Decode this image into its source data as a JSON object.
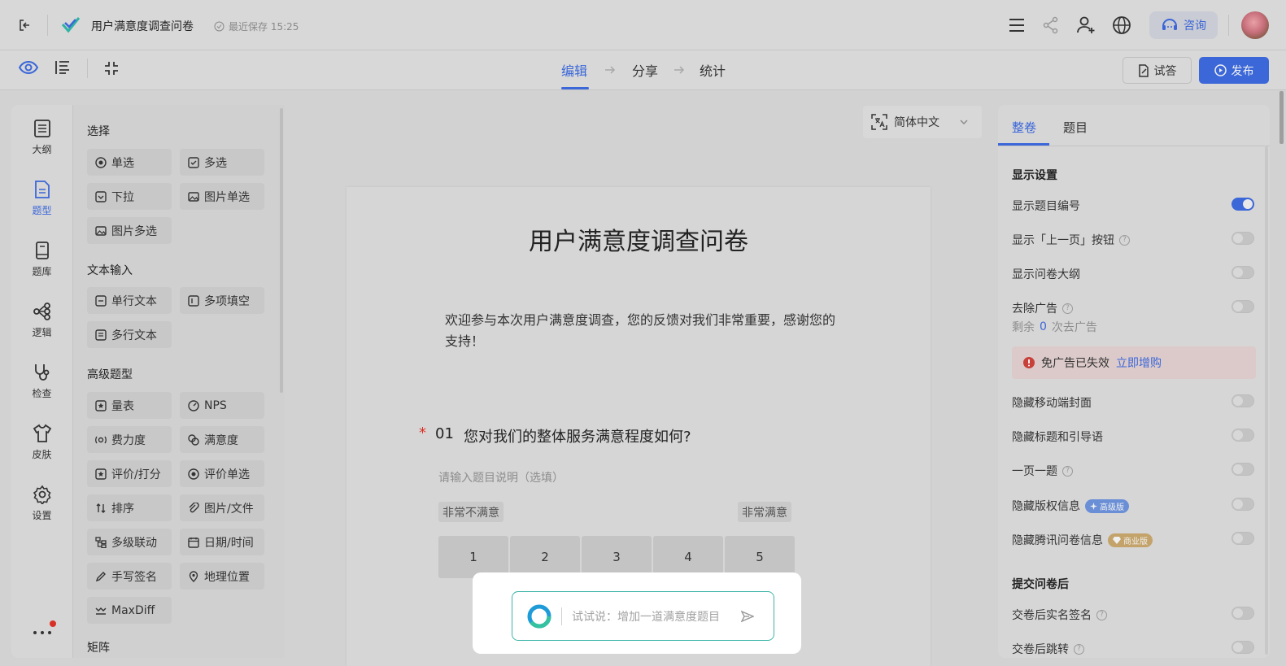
{
  "header": {
    "title": "用户满意度调查问卷",
    "saved": "最近保存 15:25",
    "consult": "咨询"
  },
  "steps": [
    "编辑",
    "分享",
    "统计"
  ],
  "actions": {
    "try": "试答",
    "publish": "发布"
  },
  "rail": [
    "大纲",
    "题型",
    "题库",
    "逻辑",
    "检查",
    "皮肤",
    "设置"
  ],
  "types": {
    "sections": [
      "选择",
      "文本输入",
      "高级题型",
      "矩阵"
    ],
    "choice": [
      "单选",
      "多选",
      "下拉",
      "图片单选",
      "图片多选"
    ],
    "text": [
      "单行文本",
      "多项填空",
      "多行文本"
    ],
    "advanced": [
      "量表",
      "NPS",
      "费力度",
      "满意度",
      "评价/打分",
      "评价单选",
      "排序",
      "图片/文件",
      "多级联动",
      "日期/时间",
      "手写签名",
      "地理位置",
      "MaxDiff"
    ]
  },
  "language": "简体中文",
  "survey": {
    "title": "用户满意度调查问卷",
    "intro": "欢迎参与本次用户满意度调查，您的反馈对我们非常重要，感谢您的支持！",
    "question": {
      "required_mark": "*",
      "number": "01",
      "text": "您对我们的整体服务满意程度如何?",
      "desc_placeholder": "请输入题目说明（选填）",
      "low_label": "非常不满意",
      "high_label": "非常满意",
      "scale": [
        "1",
        "2",
        "3",
        "4",
        "5"
      ]
    }
  },
  "ai": {
    "placeholder": "试试说：增加一道满意度题目"
  },
  "settings": {
    "tabs": [
      "整卷",
      "题目"
    ],
    "display_header": "显示设置",
    "rows": {
      "show_number": "显示题目编号",
      "show_prev": "显示「上一页」按钮",
      "show_outline": "显示问卷大纲",
      "remove_ads": "去除广告",
      "ads_left_prefix": "剩余",
      "ads_left_count": "0",
      "ads_left_suffix": "次去广告",
      "ad_expired": "免广告已失效",
      "ad_buy": "立即增购",
      "hide_cover": "隐藏移动端封面",
      "hide_title": "隐藏标题和引导语",
      "one_per_page": "一页一题",
      "hide_copyright": "隐藏版权信息",
      "badge_pro": "高级版",
      "hide_tencent": "隐藏腾讯问卷信息",
      "badge_biz": "商业版"
    },
    "submit_header": "提交问卷后",
    "submit_rows": {
      "real_name": "交卷后实名签名",
      "jump": "交卷后跳转"
    }
  },
  "colors": {
    "accent": "#3b67d8",
    "danger": "#d93025",
    "ai_border": "#3fb4a8"
  }
}
